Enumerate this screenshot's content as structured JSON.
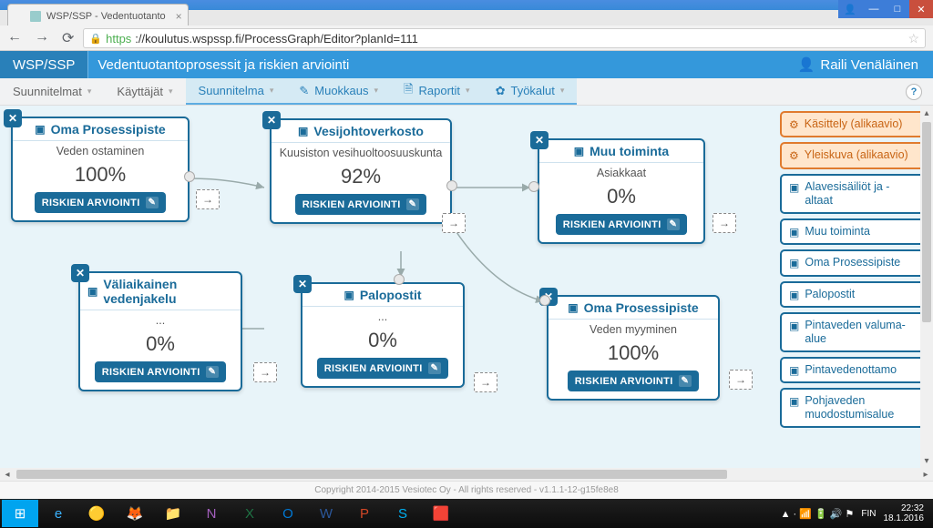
{
  "browser": {
    "tab_title": "WSP/SSP - Vedentuotanto",
    "url_https": "https",
    "url_rest": "://koulutus.wspssp.fi/ProcessGraph/Editor?planId=111"
  },
  "header": {
    "brand": "WSP/SSP",
    "title": "Vedentuotantoprosessit ja riskien arviointi",
    "user": "Raili Venäläinen"
  },
  "menu": {
    "suunnitelmat": "Suunnitelmat",
    "kayttajat": "Käyttäjät",
    "suunnitelma": "Suunnitelma",
    "muokkaus": "Muokkaus",
    "raportit": "Raportit",
    "tyokalut": "Työkalut"
  },
  "nodes": {
    "n1": {
      "title": "Oma Prosessipiste",
      "subtitle": "Veden ostaminen",
      "pct": "100%",
      "btn": "RISKIEN ARVIOINTI"
    },
    "n2": {
      "title": "Vesijohtoverkosto",
      "subtitle": "Kuusiston vesihuoltoosuuskunta",
      "pct": "92%",
      "btn": "RISKIEN ARVIOINTI"
    },
    "n3": {
      "title": "Muu toiminta",
      "subtitle": "Asiakkaat",
      "pct": "0%",
      "btn": "RISKIEN ARVIOINTI"
    },
    "n4": {
      "title": "Väliaikainen vedenjakelu",
      "subtitle": "...",
      "pct": "0%",
      "btn": "RISKIEN ARVIOINTI"
    },
    "n5": {
      "title": "Palopostit",
      "subtitle": "...",
      "pct": "0%",
      "btn": "RISKIEN ARVIOINTI"
    },
    "n6": {
      "title": "Oma Prosessipiste",
      "subtitle": "Veden myyminen",
      "pct": "100%",
      "btn": "RISKIEN ARVIOINTI"
    }
  },
  "sidebar": [
    {
      "label": "Käsittely (alikaavio)",
      "kind": "orange",
      "icon": "⚙"
    },
    {
      "label": "Yleiskuva (alikaavio)",
      "kind": "orange",
      "icon": "⚙"
    },
    {
      "label": "Alavesisäiliöt ja -altaat",
      "kind": "blue",
      "icon": "▣"
    },
    {
      "label": "Muu toiminta",
      "kind": "blue",
      "icon": "▣"
    },
    {
      "label": "Oma Prosessipiste",
      "kind": "blue",
      "icon": "▣"
    },
    {
      "label": "Palopostit",
      "kind": "blue",
      "icon": "▣"
    },
    {
      "label": "Pintaveden valuma-alue",
      "kind": "blue",
      "icon": "▣"
    },
    {
      "label": "Pintavedenottamo",
      "kind": "blue",
      "icon": "▣"
    },
    {
      "label": "Pohjaveden muodostumisalue",
      "kind": "blue",
      "icon": "▣"
    }
  ],
  "footer": "Copyright 2014-2015 Vesiotec Oy - All rights reserved - v1.1.1-12-g15fe8e8",
  "clock": {
    "time": "22:32",
    "date": "18.1.2016",
    "lang": "FIN"
  }
}
